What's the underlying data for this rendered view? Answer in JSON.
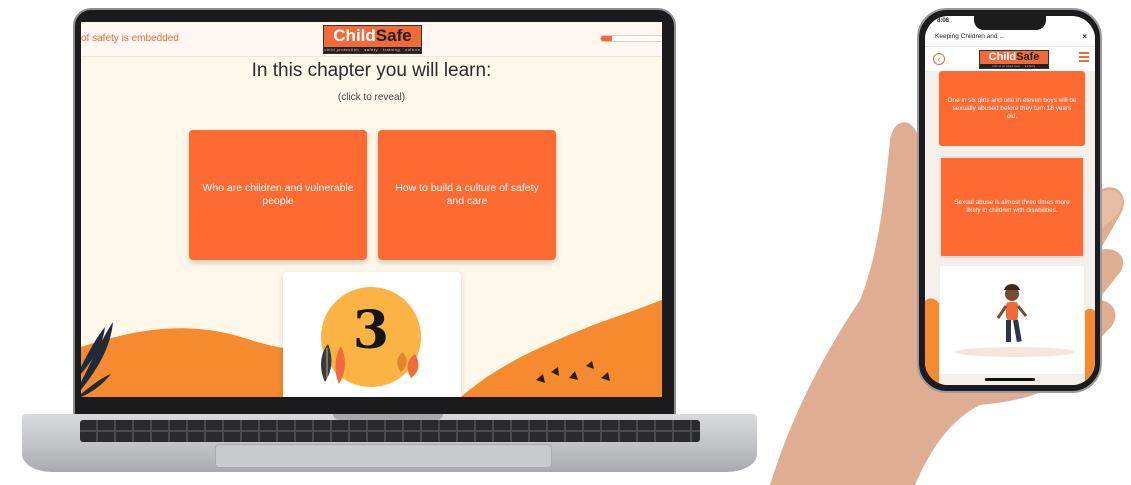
{
  "laptop": {
    "header": {
      "marquee_text": "of safety is embedded",
      "progress_percent": 18
    },
    "logo": {
      "word_light": "Child",
      "word_dark": "Safe",
      "tagline": "child protection · safety · training · culture"
    },
    "page_title": "In this chapter you will learn:",
    "page_subtitle": "(click to reveal)",
    "cards": [
      {
        "label": "Who are children and vulnerable people"
      },
      {
        "label": "How to build a culture of safety and care"
      }
    ],
    "chapter_number": "3"
  },
  "phone": {
    "status_time": "8:08",
    "tab_title": "Keeping Children and ...",
    "close_glyph": "×",
    "back_glyph": "‹",
    "logo": {
      "word_light": "Child",
      "word_dark": "Safe",
      "tagline": "child protection · safety"
    },
    "cards": [
      {
        "text": "One in six girls and one in eleven boys will be sexually abused before they turn 18 years old."
      },
      {
        "text": "Sexual abuse is almost three times more likely in children with disabilities."
      }
    ]
  },
  "colors": {
    "brand_orange": "#fd6a32",
    "screen_bg": "#fdf8ea",
    "accent_yellow": "#fbb344",
    "dark": "#222222"
  },
  "icons": [
    "back-arrow-icon",
    "hamburger-menu-icon",
    "close-icon",
    "leaf-decoration-icon"
  ]
}
